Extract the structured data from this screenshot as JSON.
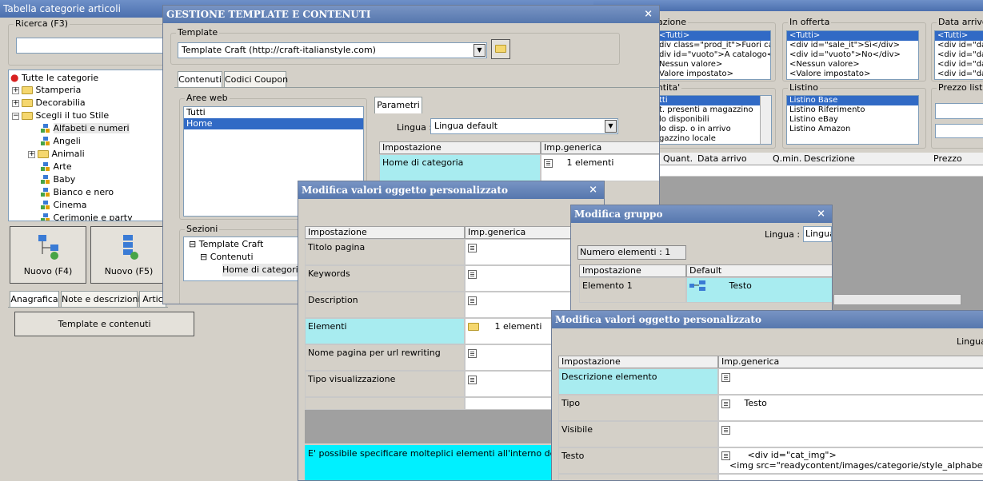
{
  "main": {
    "title": "Tabella categorie articoli",
    "search_label": "Ricerca (F3)",
    "tree": [
      {
        "label": "Tutte le categorie",
        "icon": "strawberry-icon"
      },
      {
        "label": "Stamperia",
        "icon": "folder-icon"
      },
      {
        "label": "Decorabilia",
        "icon": "folder-icon"
      },
      {
        "label": "Scegli il tuo Stile",
        "icon": "folder-icon"
      },
      {
        "label": "Alfabeti e numeri",
        "icon": "item-icon"
      },
      {
        "label": "Angeli",
        "icon": "item-icon"
      },
      {
        "label": "Animali",
        "icon": "folder-icon"
      },
      {
        "label": "Arte",
        "icon": "item-icon"
      },
      {
        "label": "Baby",
        "icon": "item-icon"
      },
      {
        "label": "Bianco e nero",
        "icon": "item-icon"
      },
      {
        "label": "Cinema",
        "icon": "item-icon"
      },
      {
        "label": "Cerimonie e party",
        "icon": "item-icon"
      }
    ],
    "new_btn_1": "Nuovo (F4)",
    "new_btn_2": "Nuovo (F5)",
    "tabs": [
      "Anagrafica",
      "Note e descrizioni",
      "Artic"
    ],
    "template_button": "Template e contenuti"
  },
  "background_filters": {
    "situazione": {
      "label": "uazione",
      "items": [
        "<Tutti>",
        "div class=\"prod_it\">Fuori catalo",
        "div id=\"vuoto\">A catalogo</di",
        "Nessun valore>",
        "Valore impostato>"
      ]
    },
    "in_offerta": {
      "label": "In offerta",
      "items": [
        "<Tutti>",
        "<div id=\"sale_it\">Sì</div>",
        "<div id=\"vuoto\">No</div>",
        "<Nessun valore>",
        "<Valore impostato>"
      ]
    },
    "data_arrivo": {
      "label": "Data arrivo",
      "items": [
        "<Tutti>",
        "<div id=\"date",
        "<div id=\"date",
        "<div id=\"date",
        "<div id=\"date"
      ]
    },
    "quantita": {
      "label": "antita'",
      "items": [
        "tti",
        "t. presenti a magazzino",
        "lo disponibili",
        "lo disp. o in arrivo",
        "gazzino locale"
      ]
    },
    "listino": {
      "label": "Listino",
      "items": [
        "Listino Base",
        "Listino Riferimento",
        "Listino eBay",
        "Listino Amazon"
      ]
    },
    "prezzo_listino": {
      "label": "Prezzo listino"
    },
    "columns": [
      "Quant.",
      "Data arrivo",
      "Q.min.",
      "Descrizione",
      "Prezzo"
    ]
  },
  "gestione": {
    "title": "GESTIONE TEMPLATE E CONTENUTI",
    "template_label": "Template",
    "template_value": "Template Craft (http://craft-italianstyle.com)",
    "tabs": [
      "Contenuti",
      "Codici Coupon"
    ],
    "aree_web_label": "Aree web",
    "aree_web": [
      "Tutti",
      "Home"
    ],
    "parametri_tab": "Parametri",
    "lingua_label": "Lingua :",
    "lingua_value": "Lingua default",
    "grid_headers": [
      "Impostazione",
      "Imp.generica"
    ],
    "grid_row": {
      "setting": "Home di categoria",
      "value": "1 elementi"
    },
    "sezioni_label": "Sezioni",
    "sezioni": [
      "Template Craft",
      "Contenuti",
      "Home di categoria a"
    ]
  },
  "modifica1": {
    "title": "Modifica valori oggetto personalizzato",
    "headers": [
      "Impostazione",
      "Imp.generica"
    ],
    "rows": [
      {
        "setting": "Titolo pagina",
        "value": ""
      },
      {
        "setting": "Keywords",
        "value": ""
      },
      {
        "setting": "Description",
        "value": ""
      },
      {
        "setting": "Elementi",
        "value": "1 elementi"
      },
      {
        "setting": "Nome pagina per url rewriting",
        "value": ""
      },
      {
        "setting": "Tipo visualizzazione",
        "value": ""
      }
    ],
    "info": "E' possibile specificare molteplici elementi all'interno del corpo pag"
  },
  "gruppo": {
    "title": "Modifica gruppo",
    "lingua_label": "Lingua :",
    "lingua_value": "Lingua",
    "num_elementi": "Numero elementi : 1",
    "headers": [
      "Impostazione",
      "Default"
    ],
    "row": {
      "setting": "Elemento 1",
      "value": "Testo"
    }
  },
  "modifica2": {
    "title": "Modifica valori oggetto personalizzato",
    "lingua_label": "Lingua",
    "headers": [
      "Impostazione",
      "Imp.generica"
    ],
    "rows": [
      {
        "setting": "Descrizione elemento",
        "value": ""
      },
      {
        "setting": "Tipo",
        "value": "Testo"
      },
      {
        "setting": "Visibile",
        "value": ""
      },
      {
        "setting": "Testo",
        "value": "<div id=\"cat_img\">",
        "value2": "<img src=\"readycontent/images/categorie/style_alphabet.jpg\""
      }
    ]
  }
}
